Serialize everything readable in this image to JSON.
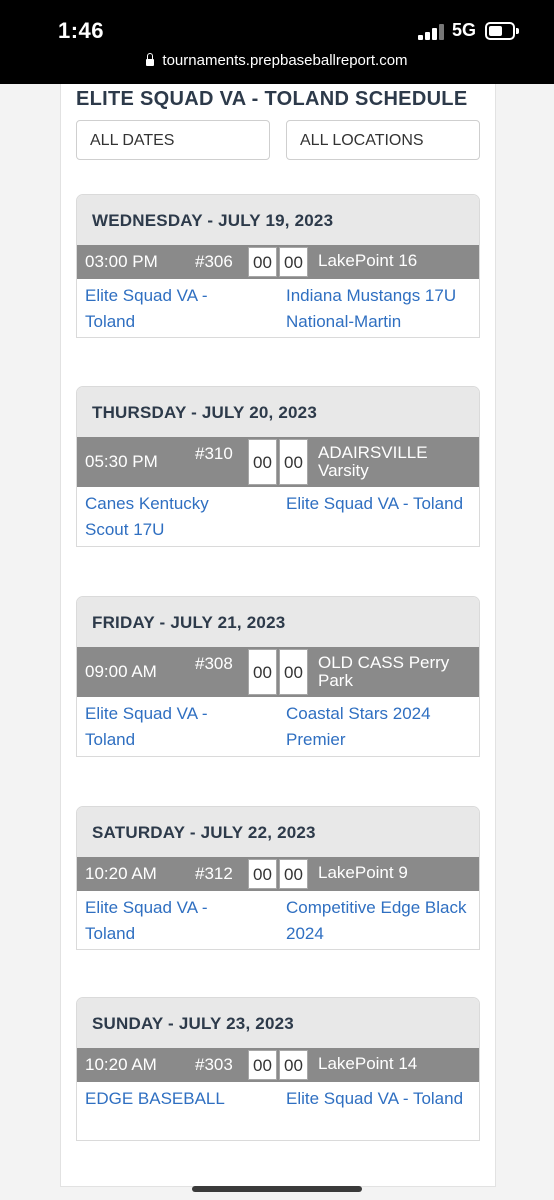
{
  "status_bar": {
    "time": "1:46",
    "network": "5G",
    "url": "tournaments.prepbaseballreport.com"
  },
  "page": {
    "title": "ELITE SQUAD VA - TOLAND SCHEDULE",
    "filters": {
      "dates": "ALL DATES",
      "locations": "ALL LOCATIONS"
    },
    "days": [
      {
        "date": "WEDNESDAY - JULY 19, 2023",
        "time": "03:00 PM",
        "game": "#306",
        "score_a": "00",
        "score_b": "00",
        "location": "LakePoint 16",
        "team_a": "Elite Squad VA - Toland",
        "team_b": "Indiana Mustangs 17U National-Martin"
      },
      {
        "date": "THURSDAY - JULY 20, 2023",
        "time": "05:30 PM",
        "game": "#310",
        "score_a": "00",
        "score_b": "00",
        "location": "ADAIRSVILLE Varsity",
        "team_a": "Canes Kentucky Scout 17U",
        "team_b": "Elite Squad VA - Toland"
      },
      {
        "date": "FRIDAY - JULY 21, 2023",
        "time": "09:00 AM",
        "game": "#308",
        "score_a": "00",
        "score_b": "00",
        "location": "OLD CASS Perry Park",
        "team_a": "Elite Squad VA - Toland",
        "team_b": "Coastal Stars 2024 Premier"
      },
      {
        "date": "SATURDAY - JULY 22, 2023",
        "time": "10:20 AM",
        "game": "#312",
        "score_a": "00",
        "score_b": "00",
        "location": "LakePoint 9",
        "team_a": "Elite Squad VA - Toland",
        "team_b": "Competitive Edge Black 2024"
      },
      {
        "date": "SUNDAY - JULY 23, 2023",
        "time": "10:20 AM",
        "game": "#303",
        "score_a": "00",
        "score_b": "00",
        "location": "LakePoint 14",
        "team_a": "EDGE BASEBALL",
        "team_b": "Elite Squad VA - Toland"
      }
    ]
  }
}
